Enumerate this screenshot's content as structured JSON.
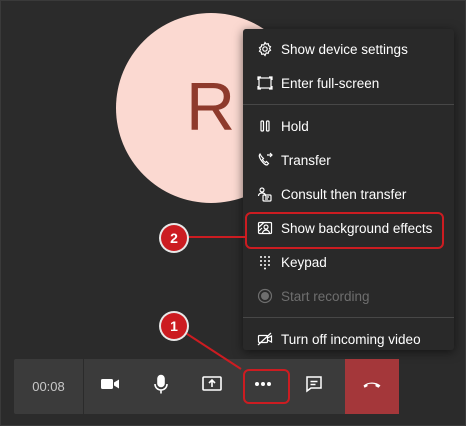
{
  "avatar": {
    "initial": "R",
    "color": "#fbd9d1",
    "text_color": "#8e3a2c"
  },
  "menu": {
    "group1": [
      {
        "label": "Show device settings",
        "icon": "gear-icon"
      },
      {
        "label": "Enter full-screen",
        "icon": "fullscreen-icon"
      }
    ],
    "group2": [
      {
        "label": "Hold",
        "icon": "pause-icon"
      },
      {
        "label": "Transfer",
        "icon": "transfer-icon"
      },
      {
        "label": "Consult then transfer",
        "icon": "consult-transfer-icon"
      },
      {
        "label": "Show background effects",
        "icon": "background-effects-icon"
      },
      {
        "label": "Keypad",
        "icon": "keypad-icon"
      },
      {
        "label": "Start recording",
        "icon": "record-icon",
        "disabled": true
      },
      {
        "label": "Turn off incoming video",
        "icon": "video-off-icon"
      }
    ]
  },
  "toolbar": {
    "timer": "00:08",
    "buttons": [
      "camera-icon",
      "microphone-icon",
      "share-screen-icon",
      "more-options-icon",
      "chat-icon",
      "hang-up-icon"
    ],
    "hangup_color": "#a4373a"
  },
  "annotations": {
    "callout1": "1",
    "callout2": "2",
    "color": "#cc1c21"
  }
}
